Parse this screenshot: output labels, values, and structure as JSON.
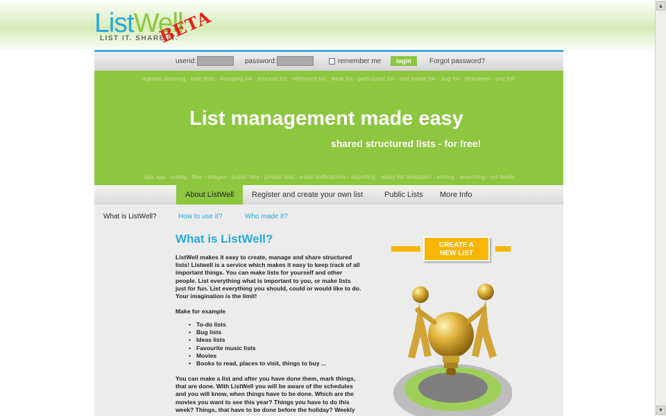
{
  "brand": {
    "name_part1": "List",
    "name_part2": "Well",
    "tagline": "LIST IT. SHARE IT.",
    "badge": "BETA"
  },
  "login": {
    "userid_label": "userid:",
    "userid_value": "",
    "password_label": "password:",
    "password_value": "",
    "remember_label": "remember me",
    "remember_checked": false,
    "login_button": "login",
    "forgot_link": "Forgot password?"
  },
  "hero": {
    "top_tags": "agenda planning - todo lists - shopping list - process list - reference list - book list - participant list - real estate list - bug list - timesheet - any list!",
    "headline": "List management made easy",
    "subheadline": "shared structured lists - for free!",
    "bottom_tags": "ajax app - voting - files - images - public lists - private lists - email notifications - exporting - ready list templates - sorting - searching - rss feeds"
  },
  "nav": {
    "tabs": [
      {
        "label": "About ListWell",
        "active": true
      },
      {
        "label": "Register and create your own list",
        "active": false
      },
      {
        "label": "Public Lists",
        "active": false
      },
      {
        "label": "More Info",
        "active": false
      }
    ]
  },
  "subnav": {
    "items": [
      {
        "label": "What is ListWell?",
        "current": true
      },
      {
        "label": "How to use it?",
        "current": false
      },
      {
        "label": "Who made it?",
        "current": false
      }
    ]
  },
  "main": {
    "heading": "What is ListWell?",
    "intro": "ListWell makes it easy to create, manage and share structured lists! Listwell is a service which makes it easy to keep track of all important things. You can make lists for yourself and other people. List everything what is important to you, or make lists just for fun. List everything you should, could or would like to do. Your imagination is the limit!",
    "examples_heading": "Make for example",
    "examples": [
      "To-do lists",
      "Bug lists",
      "Ideas lists",
      "Favourite music lists",
      "Movies",
      "Books to read, places to visit, things to buy ..."
    ],
    "paragraph2": "You can make a list and after you have done them, mark things, that are done. With ListWell you will be aware of the schedules and you will know, when things have to be done. Which are the movies you want to see this year? Things you have to do this week? Things, that have to be done before the holiday? Weekly"
  },
  "cta": {
    "line1": "CREATE A",
    "line2": "NEW LIST"
  },
  "colors": {
    "brand_green": "#8dc63f",
    "brand_blue": "#29a8d8",
    "cta_orange": "#f7b500",
    "beta_red": "#e2231a"
  }
}
